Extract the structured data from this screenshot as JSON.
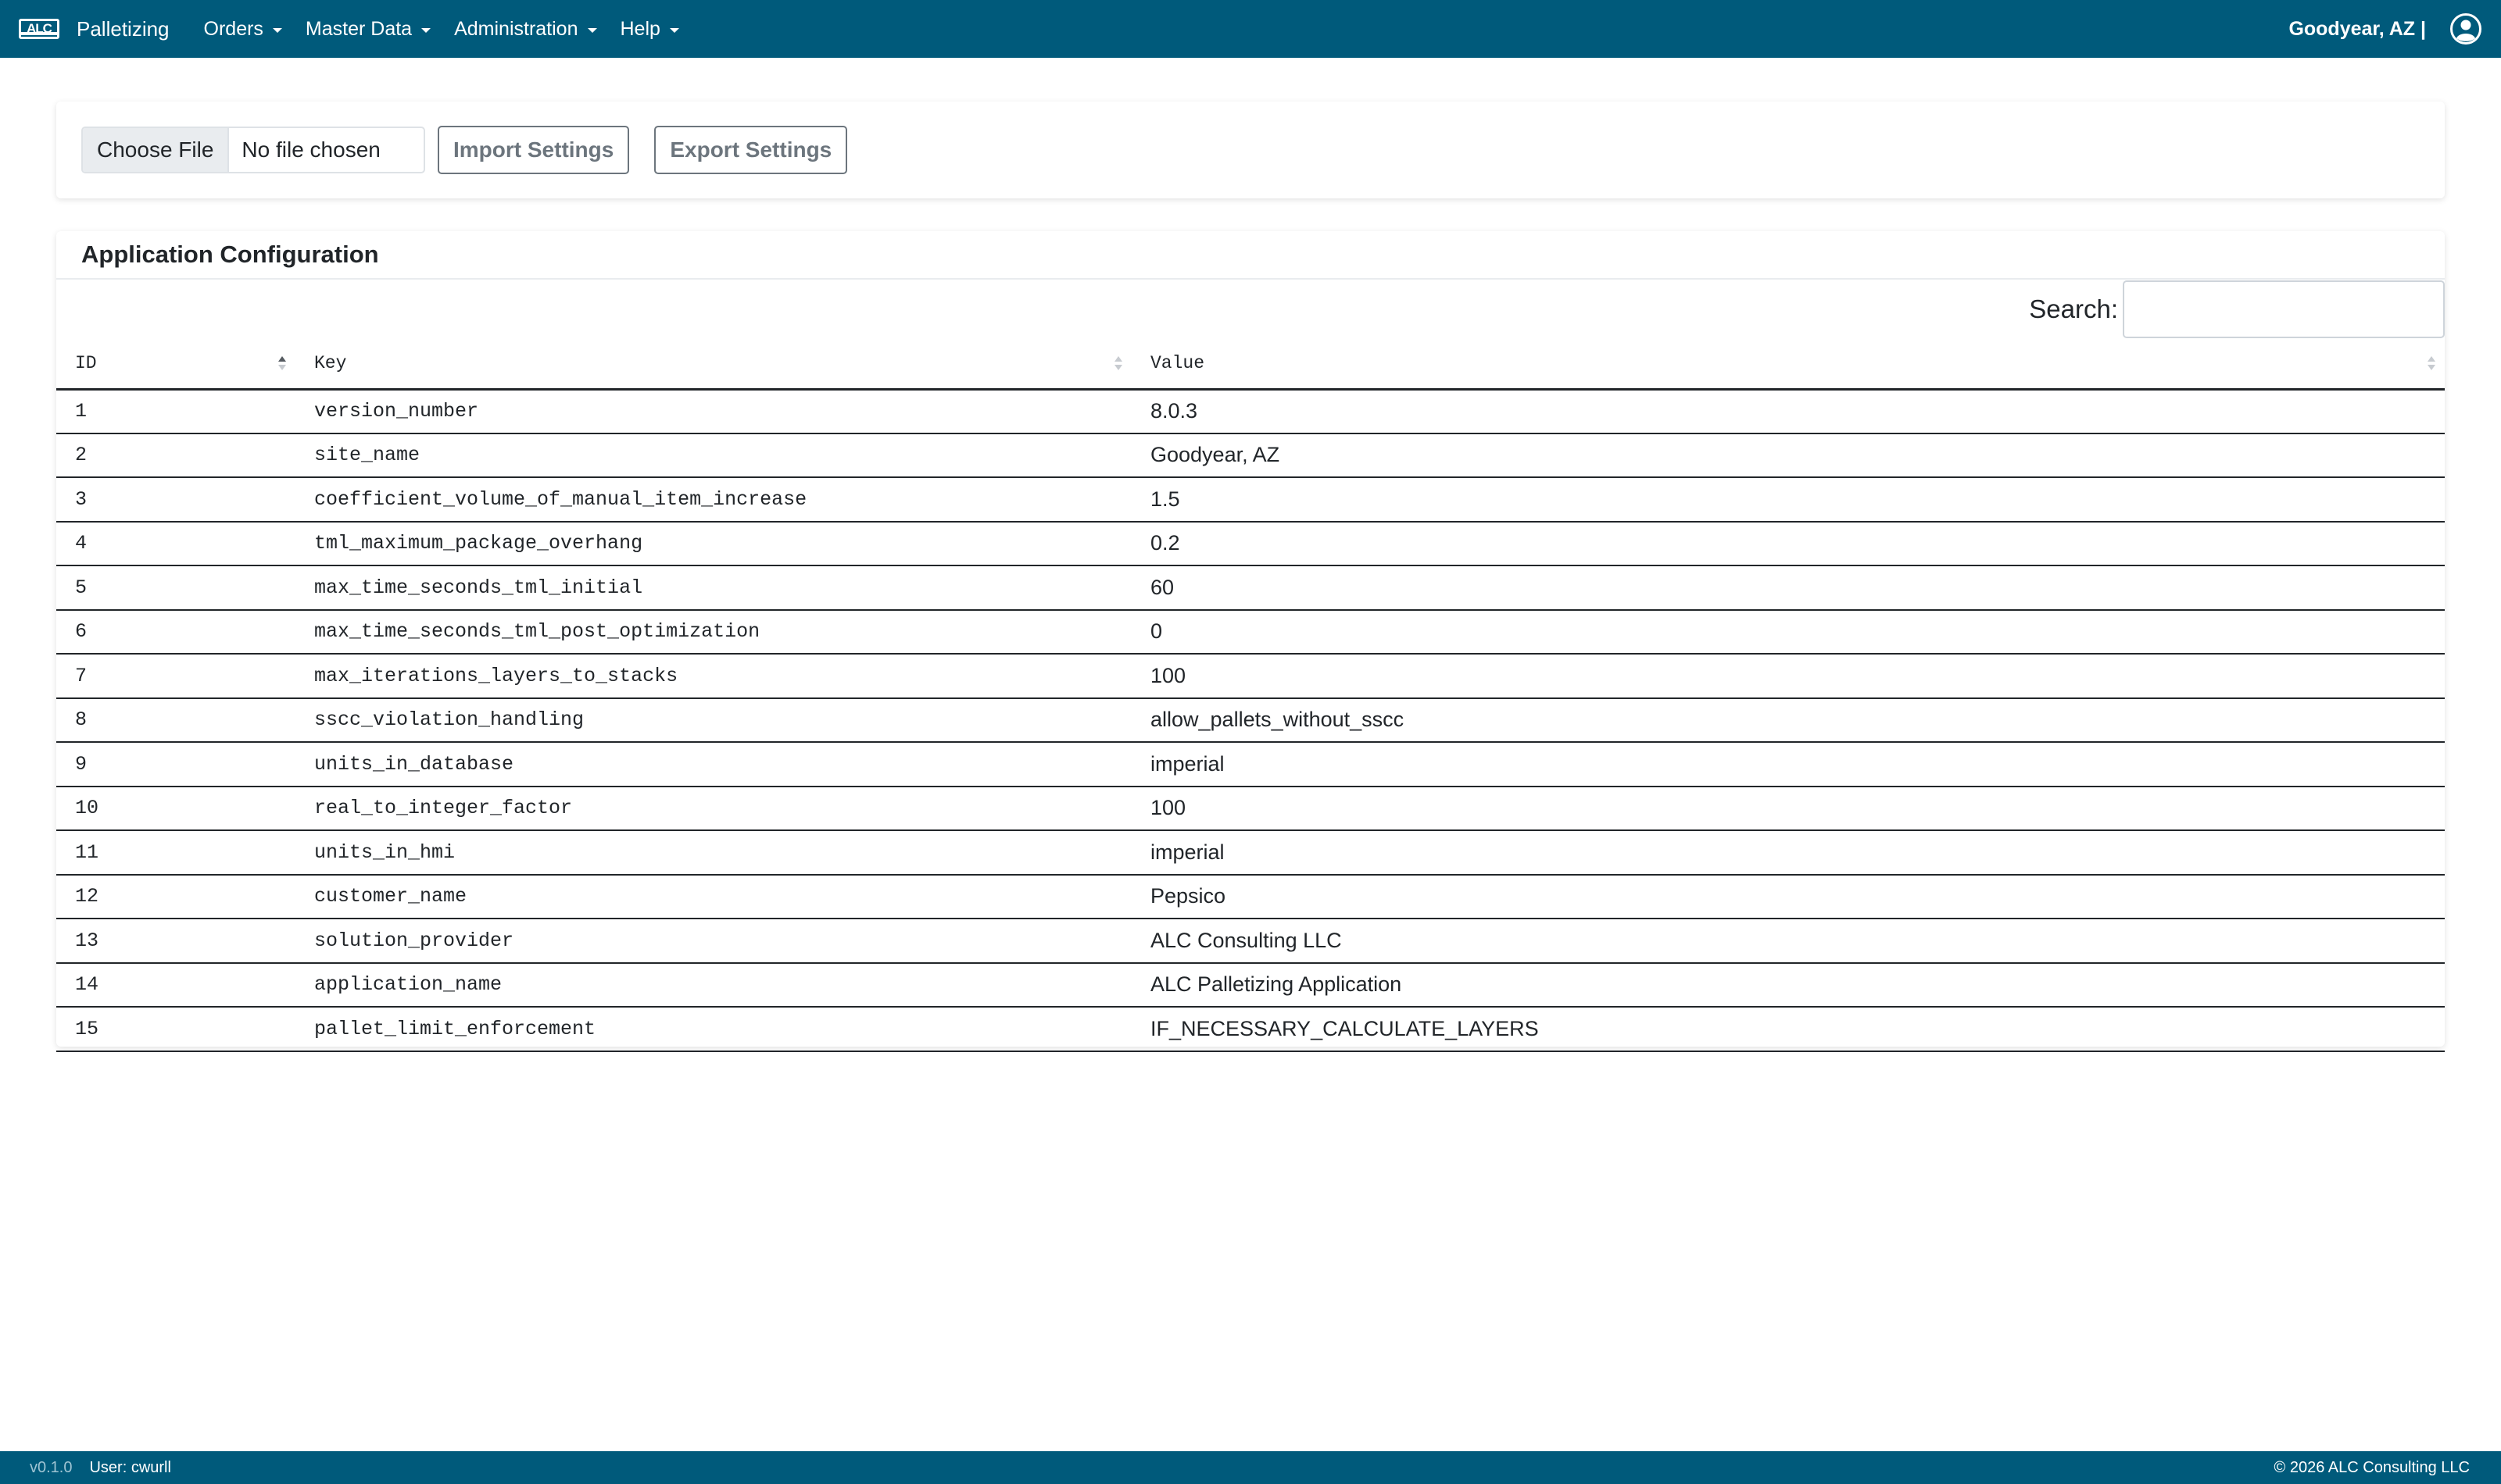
{
  "navbar": {
    "logo_text": "ALC",
    "app_name": "Palletizing",
    "menu": [
      {
        "label": "Orders"
      },
      {
        "label": "Master Data"
      },
      {
        "label": "Administration"
      },
      {
        "label": "Help"
      }
    ],
    "site": "Goodyear, AZ |",
    "user_icon": "user-circle-icon"
  },
  "import_panel": {
    "choose_file_label": "Choose File",
    "file_status": "No file chosen",
    "import_label": "Import Settings",
    "export_label": "Export Settings"
  },
  "config": {
    "title": "Application Configuration",
    "search_label": "Search:",
    "search_value": "",
    "columns": {
      "id": "ID",
      "key": "Key",
      "value": "Value"
    },
    "sorted_by": "ID ascending",
    "rows": [
      {
        "id": "1",
        "key": "version_number",
        "value": "8.0.3"
      },
      {
        "id": "2",
        "key": "site_name",
        "value": "Goodyear, AZ"
      },
      {
        "id": "3",
        "key": "coefficient_volume_of_manual_item_increase",
        "value": "1.5"
      },
      {
        "id": "4",
        "key": "tml_maximum_package_overhang",
        "value": "0.2"
      },
      {
        "id": "5",
        "key": "max_time_seconds_tml_initial",
        "value": "60"
      },
      {
        "id": "6",
        "key": "max_time_seconds_tml_post_optimization",
        "value": "0"
      },
      {
        "id": "7",
        "key": "max_iterations_layers_to_stacks",
        "value": "100"
      },
      {
        "id": "8",
        "key": "sscc_violation_handling",
        "value": "allow_pallets_without_sscc"
      },
      {
        "id": "9",
        "key": "units_in_database",
        "value": "imperial"
      },
      {
        "id": "10",
        "key": "real_to_integer_factor",
        "value": "100"
      },
      {
        "id": "11",
        "key": "units_in_hmi",
        "value": "imperial"
      },
      {
        "id": "12",
        "key": "customer_name",
        "value": "Pepsico"
      },
      {
        "id": "13",
        "key": "solution_provider",
        "value": "ALC Consulting LLC"
      },
      {
        "id": "14",
        "key": "application_name",
        "value": "ALC Palletizing Application"
      },
      {
        "id": "15",
        "key": "pallet_limit_enforcement",
        "value": "IF_NECESSARY_CALCULATE_LAYERS"
      }
    ]
  },
  "footer": {
    "version": "v0.1.0",
    "user": "User: cwurll",
    "copyright": "© 2026 ALC Consulting LLC"
  },
  "colors": {
    "primary": "#005a7b",
    "text": "#212529",
    "button_outline": "#6c757d"
  }
}
